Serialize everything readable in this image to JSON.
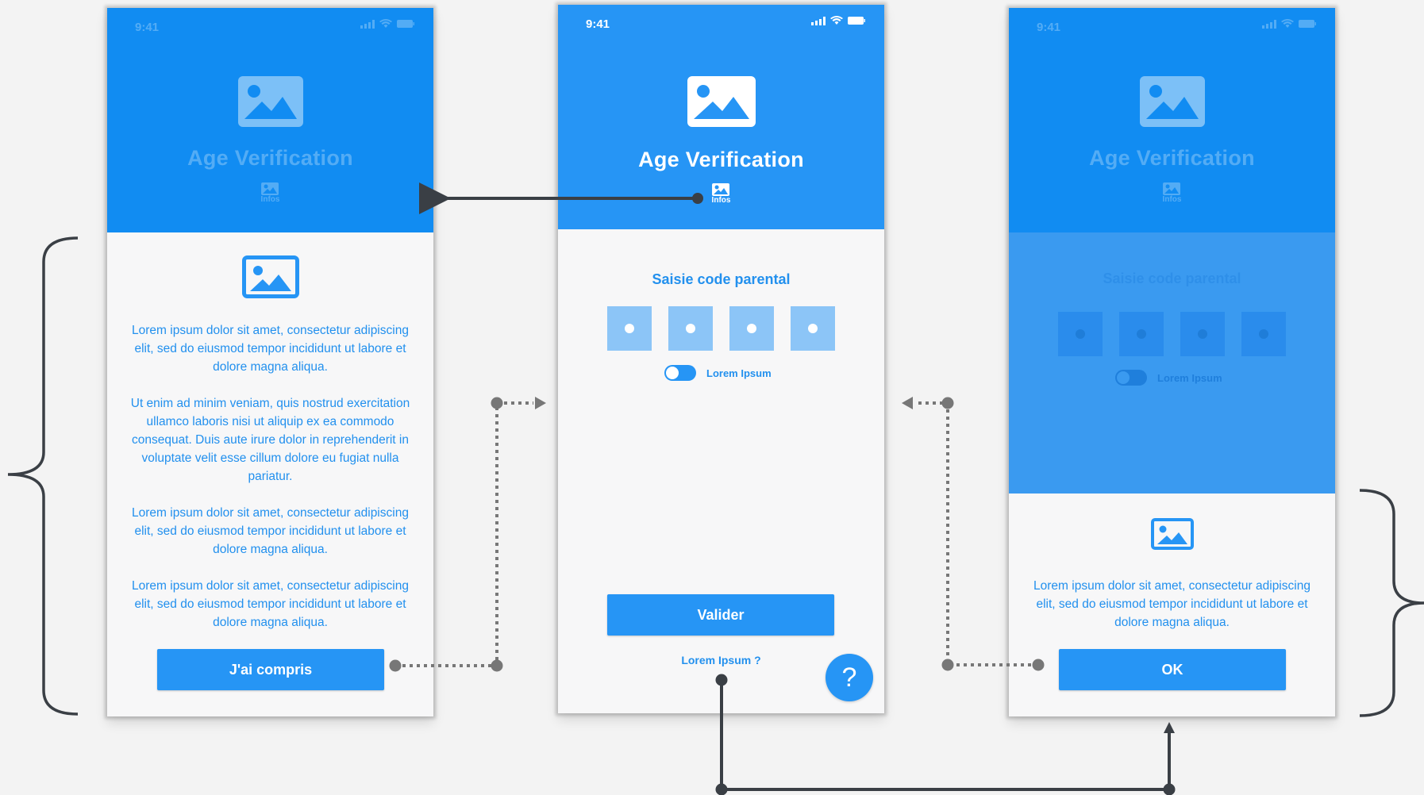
{
  "status": {
    "time": "9:41"
  },
  "screen_info": {
    "title": "Age Verification",
    "infos_label": "Infos",
    "paragraphs": [
      "Lorem ipsum dolor sit amet, consectetur adipiscing elit, sed do eiusmod tempor incididunt ut labore et dolore magna aliqua.",
      "Ut enim ad minim veniam, quis nostrud exercitation ullamco laboris nisi ut aliquip ex ea commodo consequat. Duis aute irure dolor in reprehenderit in voluptate velit esse cillum dolore eu fugiat nulla pariatur.",
      "Lorem ipsum dolor sit amet, consectetur adipiscing elit, sed do eiusmod tempor incididunt ut labore et dolore magna aliqua.",
      "Lorem ipsum dolor sit amet, consectetur adipiscing elit, sed do eiusmod tempor incididunt ut labore et dolore magna aliqua."
    ],
    "button_label": "J'ai compris"
  },
  "screen_code": {
    "title": "Age Verification",
    "infos_label": "Infos",
    "code_label": "Saisie code parental",
    "toggle_label": "Lorem Ipsum",
    "submit_label": "Valider",
    "help_link": "Lorem Ipsum ?",
    "help_fab": "?"
  },
  "screen_dialog": {
    "title": "Age Verification",
    "infos_label": "Infos",
    "code_label": "Saisie code parental",
    "toggle_label": "Lorem Ipsum",
    "message": "Lorem ipsum dolor sit amet, consectetur adipiscing elit, sed do eiusmod tempor incididunt ut labore et dolore magna aliqua.",
    "ok_label": "OK"
  },
  "colors": {
    "primary": "#2695f5",
    "primary_dim": "#118cf2",
    "text_blue": "#2290ee",
    "connector": "#3a3f45",
    "connector_dotted": "#777777",
    "background": "#f3f3f3"
  }
}
